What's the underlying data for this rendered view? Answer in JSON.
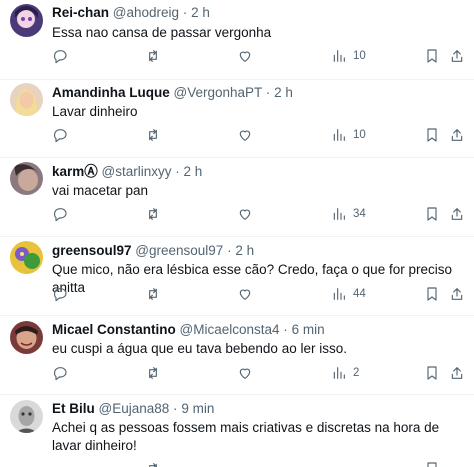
{
  "replies": [
    {
      "name": "Rei-chan",
      "handle": "@ahodreig",
      "dot": "·",
      "time": "2 h",
      "text": "Essa nao cansa de passar vergonha",
      "views": "10"
    },
    {
      "name": "Amandinha Luque",
      "handle": "@VergonhaPT",
      "dot": "·",
      "time": "2 h",
      "text": "Lavar dinheiro",
      "views": "10"
    },
    {
      "name": "karmⒶ",
      "handle": "@starlinxyy",
      "dot": "·",
      "time": "2 h",
      "text": "vai macetar pan",
      "views": "34"
    },
    {
      "name": "greensoul97",
      "handle": "@greensoul97",
      "dot": "·",
      "time": "2 h",
      "text": "Que mico, não era lésbica esse cão? Credo, faça o que for preciso anitta",
      "views": "44"
    },
    {
      "name": "Micael Constantino",
      "handle": "@Micaelconsta4",
      "dot": "·",
      "time": "6 min",
      "text": "eu cuspi a água que eu tava bebendo ao ler isso.",
      "views": "2"
    },
    {
      "name": "Et Bilu",
      "handle": "@Eujana88",
      "dot": "·",
      "time": "9 min",
      "text": "Achei q as pessoas fossem mais criativas e discretas na hora de lavar dinheiro!",
      "views": ""
    }
  ],
  "icons": {
    "reply": "reply-icon",
    "retweet": "retweet-icon",
    "like": "like-icon",
    "views": "views-icon",
    "bookmark": "bookmark-icon",
    "share": "share-icon"
  }
}
